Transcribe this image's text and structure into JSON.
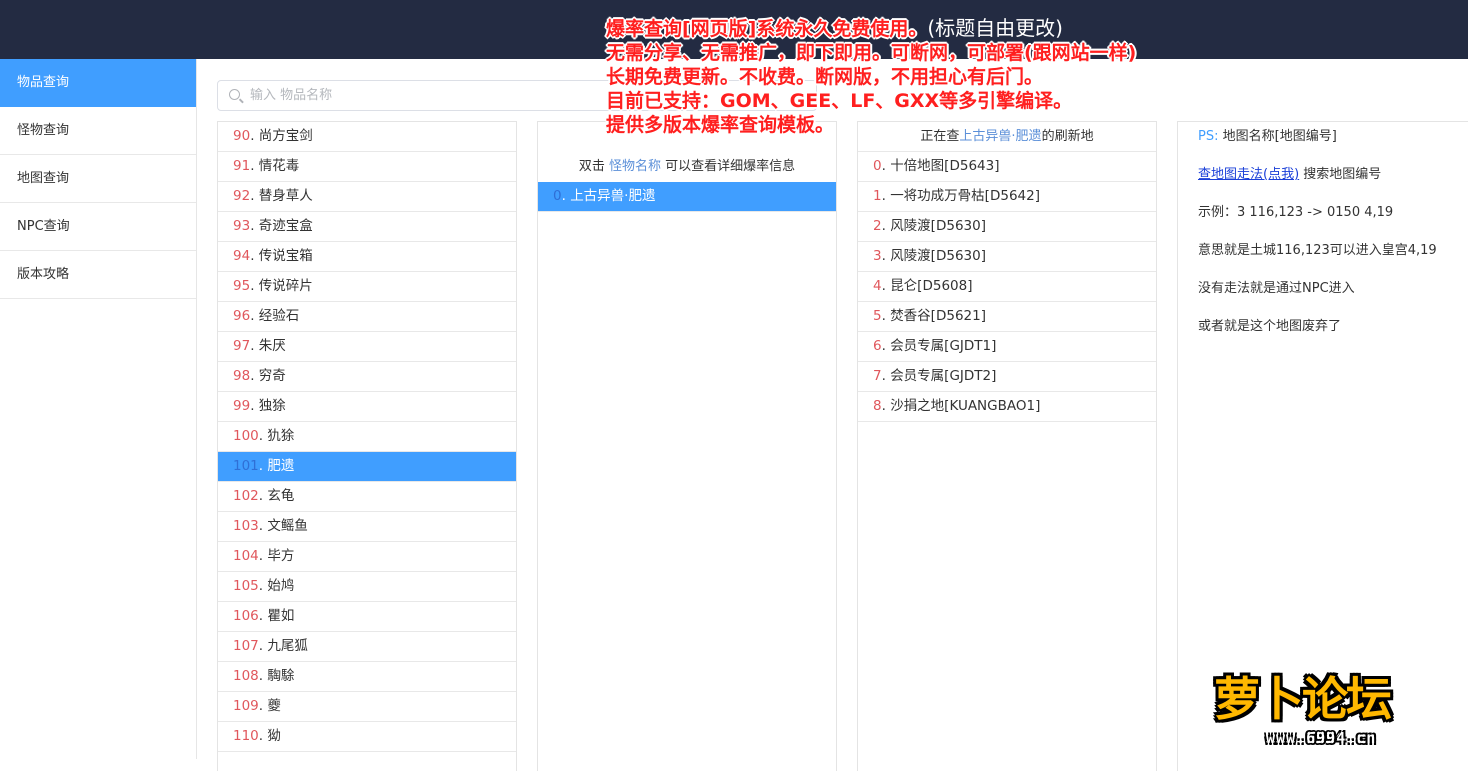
{
  "sidebar": {
    "items": [
      {
        "label": "物品查询",
        "active": true
      },
      {
        "label": "怪物查询"
      },
      {
        "label": "地图查询"
      },
      {
        "label": "NPC查询"
      },
      {
        "label": "版本攻略"
      }
    ]
  },
  "search": {
    "placeholder": "输入 物品名称",
    "value": ""
  },
  "items_list": [
    {
      "num": "90",
      "name": "尚方宝剑"
    },
    {
      "num": "91",
      "name": "情花毒"
    },
    {
      "num": "92",
      "name": "替身草人"
    },
    {
      "num": "93",
      "name": "奇迹宝盒"
    },
    {
      "num": "94",
      "name": "传说宝箱"
    },
    {
      "num": "95",
      "name": "传说碎片"
    },
    {
      "num": "96",
      "name": "经验石"
    },
    {
      "num": "97",
      "name": "朱厌"
    },
    {
      "num": "98",
      "name": "穷奇"
    },
    {
      "num": "99",
      "name": "独狳"
    },
    {
      "num": "100",
      "name": "犰狳"
    },
    {
      "num": "101",
      "name": "肥遗",
      "selected": true
    },
    {
      "num": "102",
      "name": "玄龟"
    },
    {
      "num": "103",
      "name": "文鳐鱼"
    },
    {
      "num": "104",
      "name": "毕方"
    },
    {
      "num": "105",
      "name": "始鸠"
    },
    {
      "num": "106",
      "name": "瞿如"
    },
    {
      "num": "107",
      "name": "九尾狐"
    },
    {
      "num": "108",
      "name": "騊駼"
    },
    {
      "num": "109",
      "name": "夔"
    },
    {
      "num": "110",
      "name": "狕"
    }
  ],
  "monster_panel": {
    "hint_prefix": "双击",
    "hint_link": "怪物名称",
    "hint_suffix": "可以查看详细爆率信息",
    "rows": [
      {
        "num": "0",
        "name": "上古异兽·肥遗",
        "selected": true
      }
    ]
  },
  "map_panel": {
    "header_prefix": "正在查",
    "header_link": "上古异兽·肥遗",
    "header_suffix": "的刷新地",
    "rows": [
      {
        "num": "0",
        "name": "十倍地图[D5643]"
      },
      {
        "num": "1",
        "name": "一将功成万骨枯[D5642]"
      },
      {
        "num": "2",
        "name": "风陵渡[D5630]"
      },
      {
        "num": "3",
        "name": "风陵渡[D5630]"
      },
      {
        "num": "4",
        "name": "昆仑[D5608]"
      },
      {
        "num": "5",
        "name": "焚香谷[D5621]"
      },
      {
        "num": "6",
        "name": "会员专属[GJDT1]"
      },
      {
        "num": "7",
        "name": "会员专属[GJDT2]"
      },
      {
        "num": "8",
        "name": "沙捐之地[KUANGBAO1]"
      }
    ]
  },
  "info_panel": {
    "ps_label": "PS:",
    "ps_text": "地图名称[地图编号]",
    "link_text": "查地图走法(点我)",
    "link_suffix": "搜索地图编号",
    "example": "示例：3 116,123 -> 0150 4,19",
    "meaning": "意思就是土城116,123可以进入皇宫4,19",
    "no_route": "没有走法就是通过NPC进入",
    "abandoned": "或者就是这个地图废弃了"
  },
  "banner": {
    "line1_red": "爆率查询[网页版]系统永久免费使用。",
    "line1_white": "(标题自由更改)",
    "line2": "无需分享、无需推广，即下即用。可断网，可部署(跟网站一样)",
    "line3": "长期免费更新。不收费。断网版，不用担心有后门。",
    "line4": "目前已支持：GOM、GEE、LF、GXX等多引擎编译。",
    "line5": "提供多版本爆率查询模板。"
  },
  "watermark": {
    "text": "萝卜论坛",
    "url": "www.6994.cn"
  }
}
